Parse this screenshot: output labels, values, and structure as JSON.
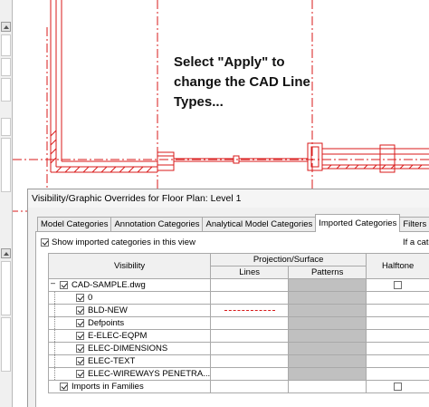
{
  "annotation": {
    "line1": "Select \"Apply\" to",
    "line2": "change the CAD Line",
    "line3": "Types..."
  },
  "dialog": {
    "title": "Visibility/Graphic Overrides for Floor Plan: Level 1",
    "tabs": [
      {
        "label": "Model Categories",
        "active": false
      },
      {
        "label": "Annotation Categories",
        "active": false
      },
      {
        "label": "Analytical Model Categories",
        "active": false
      },
      {
        "label": "Imported Categories",
        "active": true
      },
      {
        "label": "Filters",
        "active": false
      }
    ],
    "show_imported_label": "Show imported categories in this view",
    "show_imported_checked": true,
    "if_category_text": "If a cate",
    "table": {
      "header_visibility": "Visibility",
      "header_projection": "Projection/Surface",
      "header_lines": "Lines",
      "header_patterns": "Patterns",
      "header_halftone": "Halftone",
      "rows": [
        {
          "name": "CAD-SAMPLE.dwg",
          "checked": true,
          "level": 0,
          "expander": "minus",
          "halftone": false,
          "lines_override": false
        },
        {
          "name": "0",
          "checked": true,
          "level": 1,
          "halftone": false,
          "lines_override": false
        },
        {
          "name": "BLD-NEW",
          "checked": true,
          "level": 1,
          "halftone": false,
          "lines_override": true
        },
        {
          "name": "Defpoints",
          "checked": true,
          "level": 1,
          "halftone": false,
          "lines_override": false
        },
        {
          "name": "E-ELEC-EQPM",
          "checked": true,
          "level": 1,
          "halftone": false,
          "lines_override": false
        },
        {
          "name": "ELEC-DIMENSIONS",
          "checked": true,
          "level": 1,
          "halftone": false,
          "lines_override": false
        },
        {
          "name": "ELEC-TEXT",
          "checked": true,
          "level": 1,
          "halftone": false,
          "lines_override": false
        },
        {
          "name": "ELEC-WIREWAYS PENETRA...",
          "checked": true,
          "level": 1,
          "halftone": false,
          "lines_override": false
        },
        {
          "name": "Imports in Families",
          "checked": true,
          "level": 0,
          "expander": "none",
          "halftone": false,
          "lines_override": false
        }
      ]
    }
  },
  "colors": {
    "cad_red": "#d81a1a",
    "pattern_cell": "#c0c0c0"
  }
}
